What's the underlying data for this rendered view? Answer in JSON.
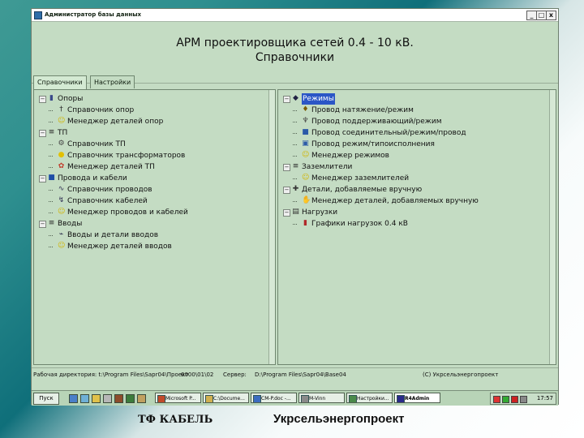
{
  "window": {
    "title": "Администратор базы данных",
    "buttons": [
      "_",
      "□",
      "x"
    ],
    "header_title": "АРМ проектировщика сетей 0.4 - 10 кВ.",
    "header_subtitle": "Справочники"
  },
  "tabs": [
    {
      "label": "Справочники",
      "active": true
    },
    {
      "label": "Настройки",
      "active": false
    }
  ],
  "left_tree": [
    {
      "label": "Опоры",
      "level": 0,
      "toggle": "−",
      "icon": "folder-icon"
    },
    {
      "label": "Справочник опор",
      "level": 1,
      "icon": "pole-icon"
    },
    {
      "label": "Менеджер деталей опор",
      "level": 1,
      "icon": "manager-icon"
    },
    {
      "label": "ТП",
      "level": 0,
      "toggle": "−",
      "icon": "tp-icon"
    },
    {
      "label": "Справочник ТП",
      "level": 1,
      "icon": "transformer-icon"
    },
    {
      "label": "Справочник трансформаторов",
      "level": 1,
      "icon": "bulb-icon"
    },
    {
      "label": "Менеджер деталей ТП",
      "level": 1,
      "icon": "gear-icon"
    },
    {
      "label": "Провода и кабели",
      "level": 0,
      "toggle": "−",
      "icon": "book-icon"
    },
    {
      "label": "Справочник проводов",
      "level": 1,
      "icon": "wire-icon"
    },
    {
      "label": "Справочник кабелей",
      "level": 1,
      "icon": "cable-icon"
    },
    {
      "label": "Менеджер проводов и кабелей",
      "level": 1,
      "icon": "manager-icon"
    },
    {
      "label": "Вводы",
      "level": 0,
      "toggle": "−",
      "icon": "input-icon"
    },
    {
      "label": "Вводы и детали вводов",
      "level": 1,
      "icon": "plug-icon"
    },
    {
      "label": "Менеджер деталей вводов",
      "level": 1,
      "icon": "manager-icon"
    }
  ],
  "right_tree": [
    {
      "label": "Режимы",
      "level": 0,
      "toggle": "−",
      "icon": "modes-icon",
      "selected": true
    },
    {
      "label": "Провод натяжение/режим",
      "level": 1,
      "icon": "tension-icon"
    },
    {
      "label": "Провод поддерживающий/режим",
      "level": 1,
      "icon": "support-icon"
    },
    {
      "label": "Провод соединительный/режим/провод",
      "level": 1,
      "icon": "connect-icon"
    },
    {
      "label": "Провод режим/типоисполнения",
      "level": 1,
      "icon": "type-icon"
    },
    {
      "label": "Менеджер режимов",
      "level": 1,
      "icon": "manager-icon"
    },
    {
      "label": "Заземлители",
      "level": 0,
      "toggle": "−",
      "icon": "ground-icon"
    },
    {
      "label": "Менеджер заземлителей",
      "level": 1,
      "icon": "manager-icon"
    },
    {
      "label": "Детали, добавляемые вручную",
      "level": 0,
      "toggle": "−",
      "icon": "parts-icon"
    },
    {
      "label": "Менеджер деталей, добавляемых вручную",
      "level": 1,
      "icon": "hand-icon"
    },
    {
      "label": "Нагрузки",
      "level": 0,
      "toggle": "−",
      "icon": "load-icon"
    },
    {
      "label": "Графики нагрузок 0.4 кВ",
      "level": 1,
      "icon": "chart-icon"
    }
  ],
  "status": {
    "workdir": "Рабочая директория: t:\\Program Files\\Sapr04\\Проект",
    "date": "0000\\01\\02",
    "server_label": "Сервер:",
    "server_path": "D:\\Program Files\\Sapr04\\Base04",
    "copyright": "(С) Укрсельэнергопроект"
  },
  "taskbar": {
    "start": "Пуск",
    "tasks": [
      {
        "label": "Microsoft P...",
        "active": false
      },
      {
        "label": "C:\\Docume...",
        "active": false
      },
      {
        "label": "CM-P.doc -...",
        "active": false
      },
      {
        "label": "M-Vinn",
        "active": false
      },
      {
        "label": "Настройки...",
        "active": false
      },
      {
        "label": "R4Admin",
        "active": true
      }
    ],
    "clock": "17:57"
  },
  "footer": {
    "left": "ТФ КАБЕЛЬ",
    "right": "Укрсельэнергопроект"
  },
  "colors": {
    "window_bg": "#c4dcc3",
    "selection": "#2b56c6"
  }
}
